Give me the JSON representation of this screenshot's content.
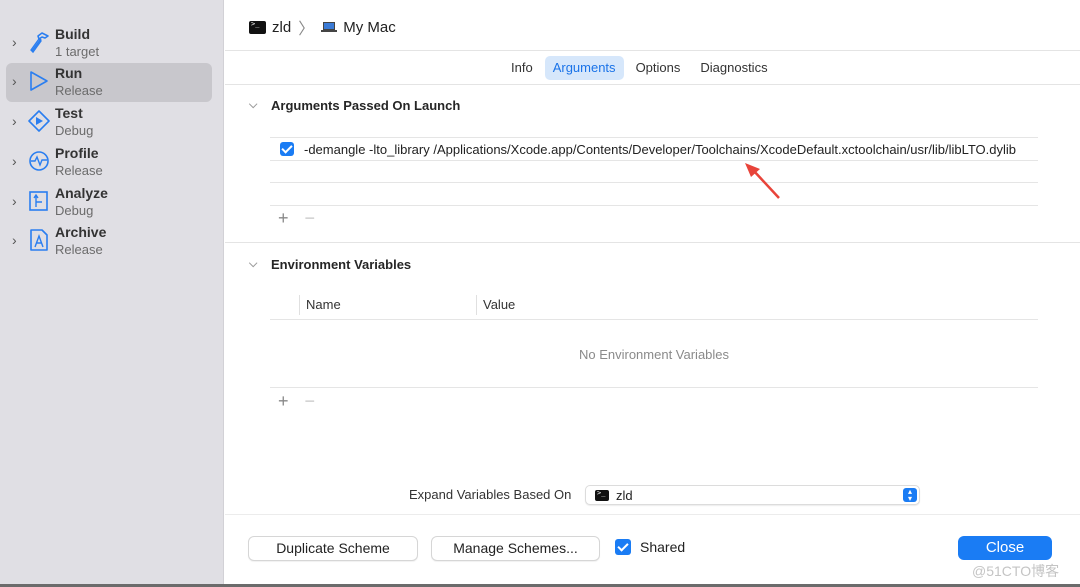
{
  "sidebar": {
    "items": [
      {
        "title": "Build",
        "subtitle": "1 target",
        "icon": "hammer-icon",
        "selected": false
      },
      {
        "title": "Run",
        "subtitle": "Release",
        "icon": "play-outline-icon",
        "selected": true
      },
      {
        "title": "Test",
        "subtitle": "Debug",
        "icon": "test-diamond-icon",
        "selected": false
      },
      {
        "title": "Profile",
        "subtitle": "Release",
        "icon": "gauge-waveform-icon",
        "selected": false
      },
      {
        "title": "Analyze",
        "subtitle": "Debug",
        "icon": "analyze-icon",
        "selected": false
      },
      {
        "title": "Archive",
        "subtitle": "Release",
        "icon": "archive-app-icon",
        "selected": false
      }
    ]
  },
  "header": {
    "scheme": "zld",
    "separator": "〉",
    "destination": "My Mac"
  },
  "tabs": [
    {
      "label": "Info",
      "active": false
    },
    {
      "label": "Arguments",
      "active": true
    },
    {
      "label": "Options",
      "active": false
    },
    {
      "label": "Diagnostics",
      "active": false
    }
  ],
  "arguments_section": {
    "title": "Arguments Passed On Launch",
    "rows": [
      {
        "enabled": true,
        "value": "-demangle -lto_library /Applications/Xcode.app/Contents/Developer/Toolchains/XcodeDefault.xctoolchain/usr/lib/libLTO.dylib"
      }
    ],
    "add_label": "+",
    "remove_label": "−"
  },
  "environment_section": {
    "title": "Environment Variables",
    "columns": [
      "Name",
      "Value"
    ],
    "empty_message": "No Environment Variables",
    "add_label": "+",
    "remove_label": "−"
  },
  "expand_variables": {
    "label": "Expand Variables Based On",
    "value": "zld"
  },
  "footer": {
    "duplicate_label": "Duplicate Scheme",
    "manage_label": "Manage Schemes...",
    "shared_label": "Shared",
    "shared_checked": true,
    "close_label": "Close"
  },
  "watermark": "@51CTO博客",
  "colors": {
    "accent": "#1a7cf4",
    "annotation_arrow": "#e8443a",
    "sidebar_bg": "#e0dfe4"
  }
}
